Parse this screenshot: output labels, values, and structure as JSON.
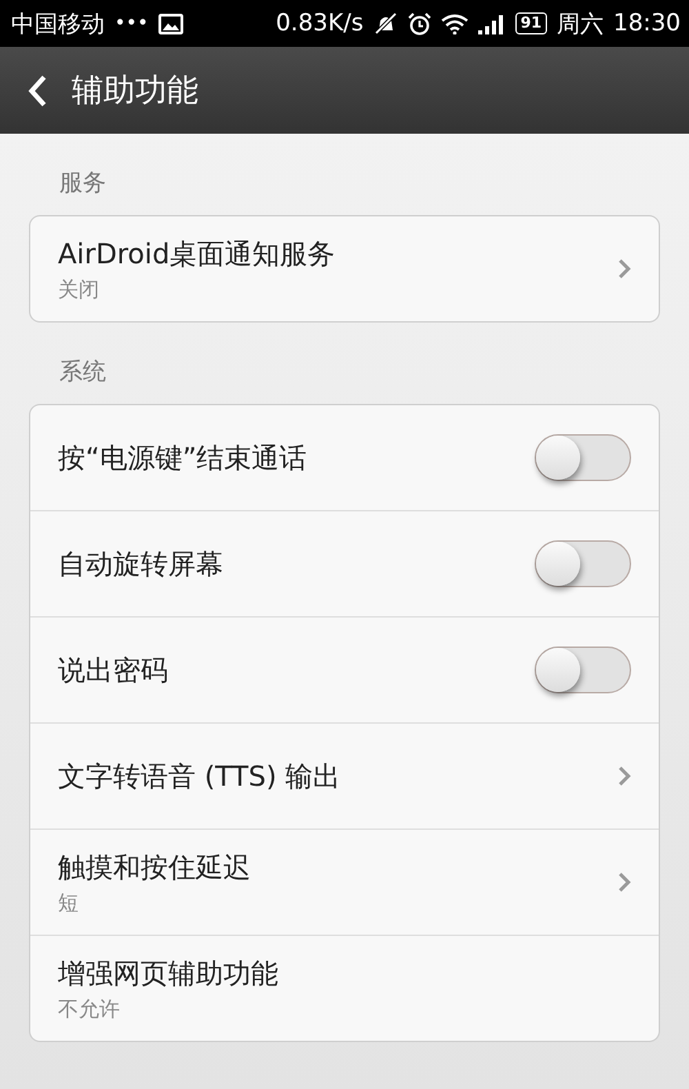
{
  "status_bar": {
    "carrier": "中国移动",
    "dots": "•••",
    "speed": "0.83K/s",
    "battery": "91",
    "day": "周六",
    "time": "18:30"
  },
  "header": {
    "title": "辅助功能"
  },
  "sections": [
    {
      "label": "服务",
      "items": [
        {
          "kind": "nav",
          "title": "AirDroid桌面通知服务",
          "subtitle": "关闭"
        }
      ]
    },
    {
      "label": "系统",
      "items": [
        {
          "kind": "toggle",
          "title": "按“电源键”结束通话",
          "on": false
        },
        {
          "kind": "toggle",
          "title": "自动旋转屏幕",
          "on": false
        },
        {
          "kind": "toggle",
          "title": "说出密码",
          "on": false
        },
        {
          "kind": "nav",
          "title": "文字转语音 (TTS) 输出"
        },
        {
          "kind": "nav",
          "title": "触摸和按住延迟",
          "subtitle": "短"
        },
        {
          "kind": "text",
          "title": "增强网页辅助功能",
          "subtitle": "不允许"
        }
      ]
    }
  ]
}
